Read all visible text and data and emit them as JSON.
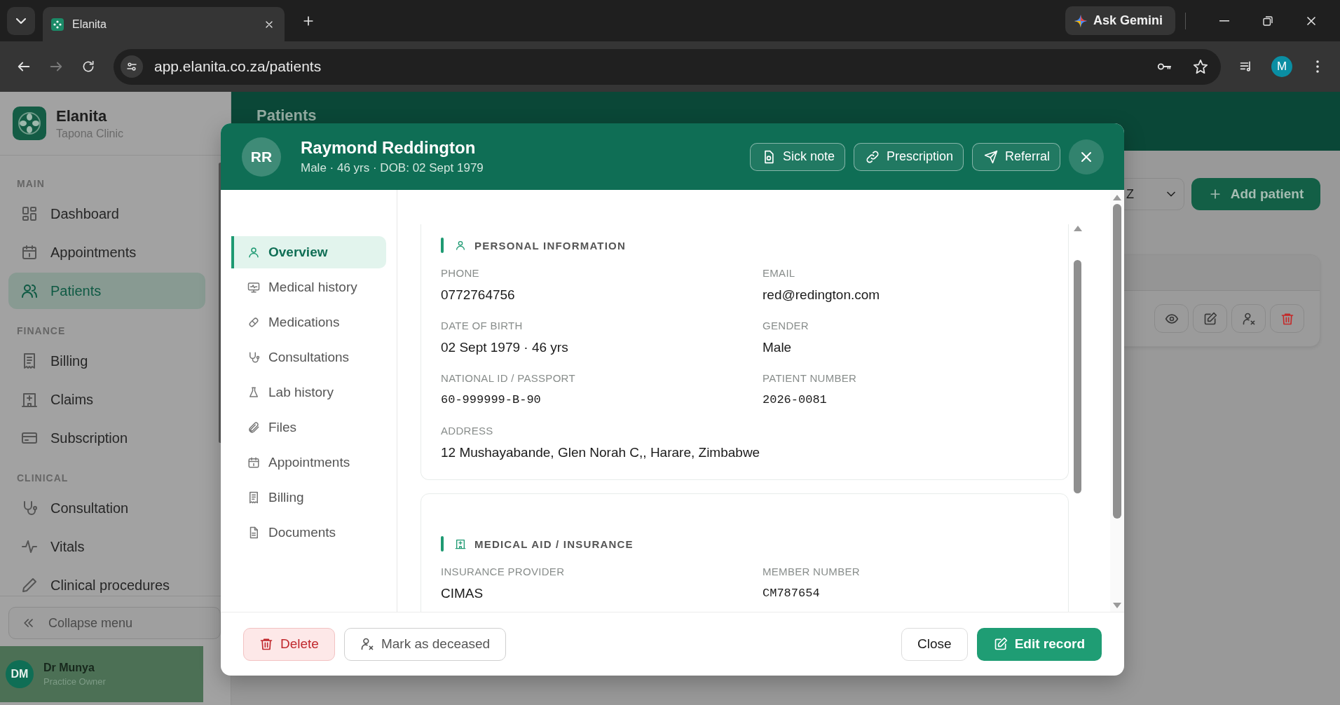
{
  "browser": {
    "tabs": [
      {
        "title": "Elanita",
        "selected": true
      }
    ],
    "gemini_button": "Ask Gemini",
    "url": "app.elanita.co.za/patients",
    "profile_initial": "M"
  },
  "sidebar": {
    "brand": "Elanita",
    "clinic": "Tapona Clinic",
    "sections": [
      {
        "label": "MAIN",
        "items": [
          {
            "label": "Dashboard",
            "selected": false
          },
          {
            "label": "Appointments",
            "selected": false
          },
          {
            "label": "Patients",
            "selected": true
          }
        ]
      },
      {
        "label": "FINANCE",
        "items": [
          {
            "label": "Billing",
            "selected": false
          },
          {
            "label": "Claims",
            "selected": false
          },
          {
            "label": "Subscription",
            "selected": false
          }
        ]
      },
      {
        "label": "CLINICAL",
        "items": [
          {
            "label": "Consultation",
            "selected": false
          },
          {
            "label": "Vitals",
            "selected": false
          },
          {
            "label": "Clinical procedures",
            "selected": false
          }
        ]
      }
    ],
    "collapse_button": "Collapse menu",
    "user": {
      "initials": "DM",
      "name": "Dr Munya",
      "role": "Practice Owner"
    }
  },
  "page": {
    "title": "Patients",
    "filter_value": "Z",
    "add_button": "Add patient"
  },
  "modal": {
    "initials": "RR",
    "name": "Raymond Reddington",
    "subtitle": "Male · 46 yrs · DOB: 02 Sept 1979",
    "actions": [
      "Sick note",
      "Prescription",
      "Referral"
    ],
    "nav": [
      {
        "label": "Overview",
        "selected": true
      },
      {
        "label": "Medical history",
        "selected": false
      },
      {
        "label": "Medications",
        "selected": false
      },
      {
        "label": "Consultations",
        "selected": false
      },
      {
        "label": "Lab history",
        "selected": false
      },
      {
        "label": "Files",
        "selected": false
      },
      {
        "label": "Appointments",
        "selected": false
      },
      {
        "label": "Billing",
        "selected": false
      },
      {
        "label": "Documents",
        "selected": false
      }
    ],
    "sections": [
      {
        "title": "PERSONAL INFORMATION",
        "fields": [
          {
            "label": "PHONE",
            "value": "0772764756",
            "kind": "text"
          },
          {
            "label": "EMAIL",
            "value": "red@redington.com",
            "kind": "text"
          },
          {
            "label": "DATE OF BIRTH",
            "value": "02 Sept 1979 · 46 yrs",
            "kind": "text"
          },
          {
            "label": "GENDER",
            "value": "Male",
            "kind": "text"
          },
          {
            "label": "NATIONAL ID / PASSPORT",
            "value": "60-999999-B-90",
            "kind": "mono"
          },
          {
            "label": "PATIENT NUMBER",
            "value": "2026-0081",
            "kind": "mono"
          },
          {
            "label": "ADDRESS",
            "value": "12 Mushayabande, Glen Norah C,, Harare, Zimbabwe",
            "kind": "text"
          }
        ]
      },
      {
        "title": "MEDICAL AID / INSURANCE",
        "fields": [
          {
            "label": "INSURANCE PROVIDER",
            "value": "CIMAS",
            "kind": "text"
          },
          {
            "label": "MEMBER NUMBER",
            "value": "CM787654",
            "kind": "mono"
          }
        ]
      }
    ],
    "left_actions": [
      {
        "label": "Delete",
        "kind": "danger"
      },
      {
        "label": "Mark as deceased",
        "kind": "secondary"
      }
    ],
    "right_actions": [
      {
        "label": "Close",
        "kind": "plain"
      },
      {
        "label": "Edit record",
        "kind": "primary"
      }
    ]
  }
}
